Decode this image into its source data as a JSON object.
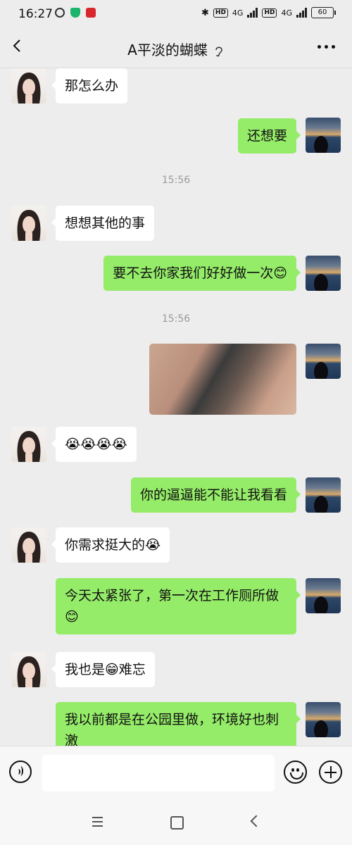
{
  "status_bar": {
    "time": "16:27",
    "network_1": "4G",
    "network_2": "4G",
    "hd": "HD",
    "battery": "60"
  },
  "header": {
    "title": "A平淡的蝴蝶"
  },
  "messages": [
    {
      "side": "left",
      "text": "那怎么办"
    },
    {
      "side": "right",
      "text": "还想要"
    },
    {
      "type": "time",
      "text": "15:56"
    },
    {
      "side": "left",
      "text": "想想其他的事"
    },
    {
      "side": "right",
      "text": "要不去你家我们好好做一次😊"
    },
    {
      "type": "time",
      "text": "15:56"
    },
    {
      "side": "right",
      "type": "image"
    },
    {
      "side": "left",
      "text": "😭😭😭😭"
    },
    {
      "side": "right",
      "text": "你的逼逼能不能让我看看"
    },
    {
      "side": "left",
      "text": "你需求挺大的😭"
    },
    {
      "side": "right",
      "text": "今天太紧张了，第一次在工作厕所做😊"
    },
    {
      "side": "left",
      "text": "我也是😁难忘"
    },
    {
      "side": "right",
      "text": "我以前都是在公园里做，环境好也刺激"
    }
  ],
  "input": {
    "placeholder": ""
  },
  "icons": {
    "back": "back-arrow-icon",
    "ear": "ear-icon",
    "more": "more-icon",
    "voice": "voice-icon",
    "emoji": "emoji-icon",
    "plus": "plus-icon"
  },
  "colors": {
    "sent_bubble": "#95ec69",
    "received_bubble": "#ffffff",
    "background": "#ededed"
  }
}
